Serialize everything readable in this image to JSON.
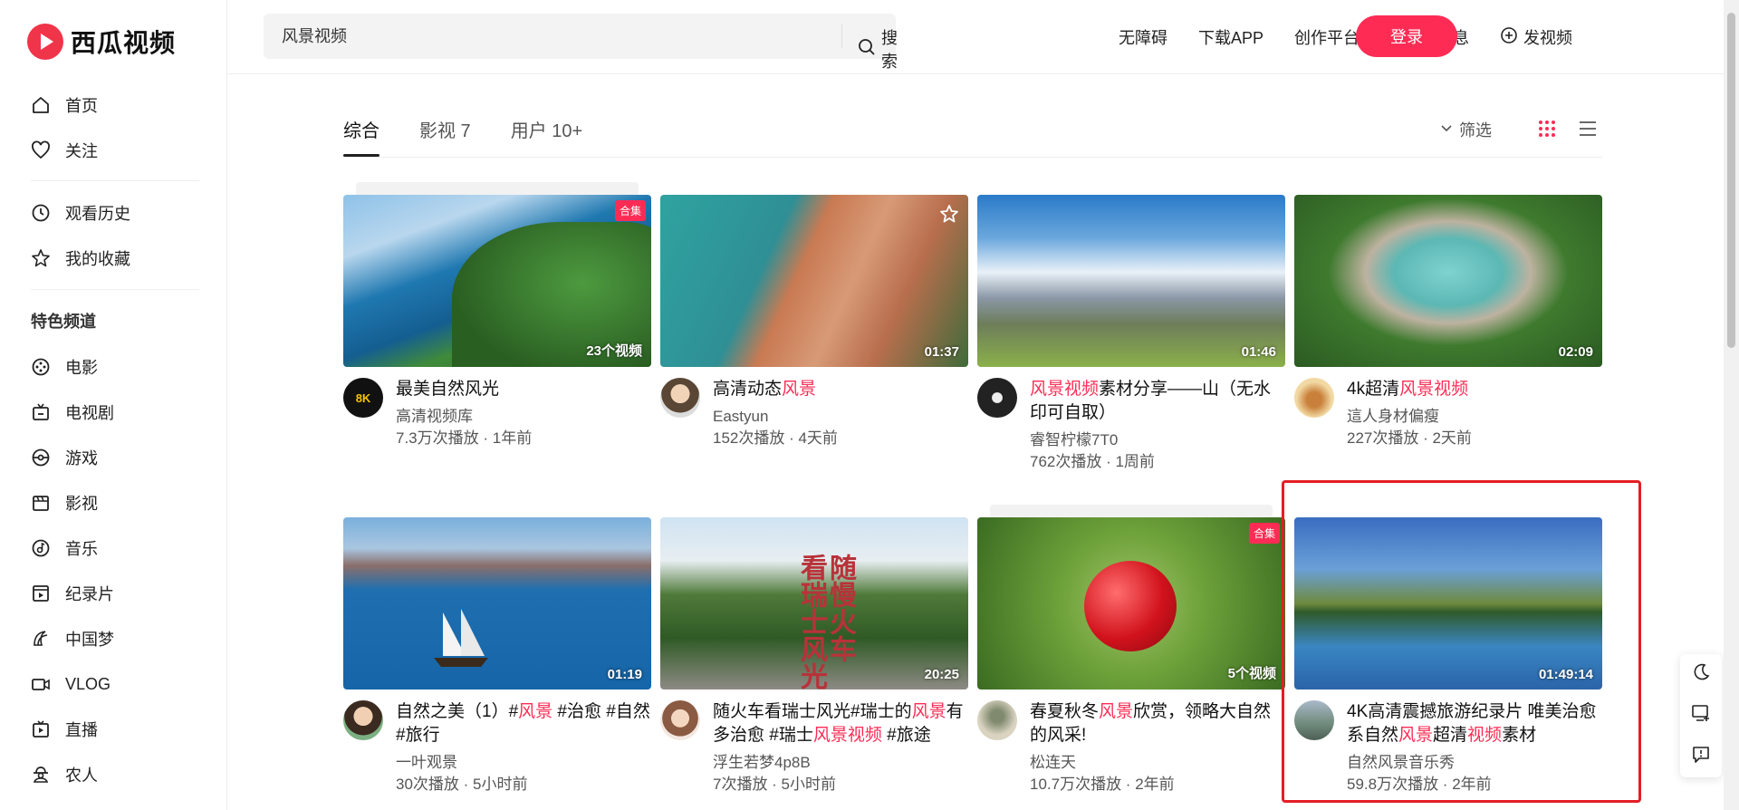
{
  "app": {
    "name": "西瓜视频"
  },
  "sidebar": {
    "items_top": [
      {
        "label": "首页",
        "icon": "home-icon"
      },
      {
        "label": "关注",
        "icon": "heart-icon"
      }
    ],
    "items_mid": [
      {
        "label": "观看历史",
        "icon": "clock-icon"
      },
      {
        "label": "我的收藏",
        "icon": "star-icon"
      }
    ],
    "section_title": "特色频道",
    "channels": [
      {
        "label": "电影",
        "icon": "film-icon"
      },
      {
        "label": "电视剧",
        "icon": "tv-icon"
      },
      {
        "label": "游戏",
        "icon": "game-icon"
      },
      {
        "label": "影视",
        "icon": "clapper-icon"
      },
      {
        "label": "音乐",
        "icon": "music-icon"
      },
      {
        "label": "纪录片",
        "icon": "documentary-icon"
      },
      {
        "label": "中国梦",
        "icon": "dream-icon"
      },
      {
        "label": "VLOG",
        "icon": "camera-icon"
      },
      {
        "label": "直播",
        "icon": "live-icon"
      },
      {
        "label": "农人",
        "icon": "farmer-icon"
      }
    ]
  },
  "header": {
    "search_value": "风景视频",
    "search_button": "搜索",
    "links": [
      "无障碍",
      "下载APP",
      "创作平台"
    ],
    "messages": "消息",
    "upload": "发视频",
    "login": "登录"
  },
  "tabs": [
    {
      "label": "综合"
    },
    {
      "label": "影视 7"
    },
    {
      "label": "用户 10+"
    }
  ],
  "filter_label": "筛选",
  "accent_color": "#fe2c55",
  "cards": [
    {
      "title_parts": [
        {
          "t": "最美自然风光",
          "hl": false
        }
      ],
      "author": "高清视频库",
      "stats": "7.3万次播放 · 1年前",
      "duration": "23个视频",
      "badge": "合集"
    },
    {
      "title_parts": [
        {
          "t": "高清动态",
          "hl": false
        },
        {
          "t": "风景",
          "hl": true
        }
      ],
      "author": "Eastyun",
      "stats": "152次播放 · 4天前",
      "duration": "01:37",
      "badge": ""
    },
    {
      "title_parts": [
        {
          "t": "风景视频",
          "hl": true
        },
        {
          "t": "素材分享——山（无水印可自取）",
          "hl": false
        }
      ],
      "author": "睿智柠檬7T0",
      "stats": "762次播放 · 1周前",
      "duration": "01:46",
      "badge": ""
    },
    {
      "title_parts": [
        {
          "t": "4k超清",
          "hl": false
        },
        {
          "t": "风景视频",
          "hl": true
        }
      ],
      "author": "這人身材偏瘦",
      "stats": "227次播放 · 2天前",
      "duration": "02:09",
      "badge": ""
    },
    {
      "title_parts": [
        {
          "t": "自然之美（1）#",
          "hl": false
        },
        {
          "t": "风景",
          "hl": true
        },
        {
          "t": " #治愈 #自然 #旅行",
          "hl": false
        }
      ],
      "author": "一叶观景",
      "stats": "30次播放 · 5小时前",
      "duration": "01:19",
      "badge": ""
    },
    {
      "title_parts": [
        {
          "t": "随火车看瑞士风光#瑞士的",
          "hl": false
        },
        {
          "t": "风景",
          "hl": true
        },
        {
          "t": "有多治愈 #瑞士",
          "hl": false
        },
        {
          "t": "风景视频",
          "hl": true
        },
        {
          "t": " #旅途",
          "hl": false
        }
      ],
      "author": "浮生若梦4p8B",
      "stats": "7次播放 · 5小时前",
      "duration": "20:25",
      "badge": ""
    },
    {
      "title_parts": [
        {
          "t": "春夏秋冬",
          "hl": false
        },
        {
          "t": "风景",
          "hl": true
        },
        {
          "t": "欣赏，领略大自然的风采!",
          "hl": false
        }
      ],
      "author": "松连天",
      "stats": "10.7万次播放 · 2年前",
      "duration": "5个视频",
      "badge": "合集"
    },
    {
      "title_parts": [
        {
          "t": "4K高清震撼旅游纪录片 唯美治愈系自然",
          "hl": false
        },
        {
          "t": "风景",
          "hl": true
        },
        {
          "t": "超清",
          "hl": false
        },
        {
          "t": "视频",
          "hl": true
        },
        {
          "t": "素材",
          "hl": false
        }
      ],
      "author": "自然风景音乐秀",
      "stats": "59.8万次播放 · 2年前",
      "duration": "01:49:14",
      "badge": ""
    }
  ]
}
